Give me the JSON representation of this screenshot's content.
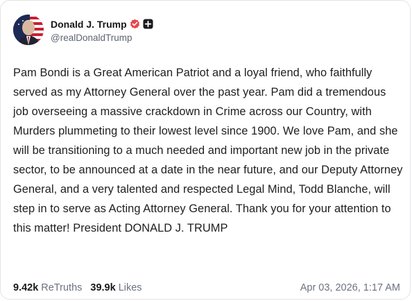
{
  "post": {
    "author": {
      "display_name": "Donald J. Trump",
      "handle": "@realDonaldTrump",
      "verified": true,
      "verified_color": "#e5484d",
      "plus_badge": true
    },
    "text": "Pam Bondi is a Great American Patriot and a loyal friend, who faithfully served as my Attorney General over the past year. Pam did a tremendous job overseeing a massive crackdown in Crime across our Country, with Murders plummeting to their lowest level since 1900. We love Pam, and she will be transitioning to a much needed and important new job in the private sector, to be announced at a date in the near future, and our Deputy Attorney General, and a very talented and respected Legal Mind, Todd Blanche, will step in to serve as Acting Attorney General. Thank you for your attention to this matter! President DONALD J. TRUMP",
    "stats": {
      "retruths_count": "9.42k",
      "retruths_label": "ReTruths",
      "likes_count": "39.9k",
      "likes_label": "Likes"
    },
    "timestamp": "Apr 03, 2026, 1:17 AM"
  }
}
